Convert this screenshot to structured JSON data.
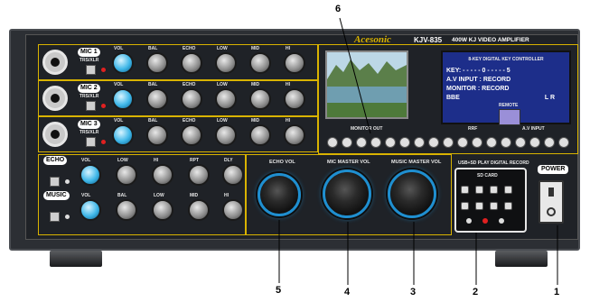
{
  "brand": {
    "logo": "Acesonic",
    "model": "KJV-835",
    "subtitle": "400W KJ VIDEO AMPLIFIER"
  },
  "mic_channels": [
    {
      "label": "MIC 1",
      "sub": "TRS/XLR"
    },
    {
      "label": "MIC 2",
      "sub": "TRS/XLR"
    },
    {
      "label": "MIC 3",
      "sub": "TRS/XLR"
    }
  ],
  "mic_knob_labels": [
    "VOL",
    "BAL",
    "ECHO",
    "LOW",
    "MID",
    "HI"
  ],
  "echo_section": {
    "label": "ECHO",
    "knob_labels": [
      "VOL",
      "LOW",
      "HI",
      "RPT",
      "DLY"
    ]
  },
  "music_section": {
    "label": "MUSIC",
    "knob_labels": [
      "VOL",
      "BAL",
      "LOW",
      "MID",
      "HI"
    ]
  },
  "master_knobs": [
    "ECHO VOL",
    "MIC MASTER VOL",
    "MUSIC MASTER VOL"
  ],
  "usb_section": {
    "title": "USB+SD PLAY DIGITAL RECORD",
    "card_label": "SD CARD"
  },
  "power_label": "POWER",
  "lcd": {
    "header": "8-KEY DIGITAL KEY CONTROLLER",
    "line1": "KEY:  - - - - - 0 - - - - - 5",
    "line2": "A.V INPUT : RECORD",
    "line3": "MONITOR : RECORD",
    "line4_left": "BBE",
    "line4_right": "L   R",
    "remote_label": "REMOTE"
  },
  "video_buttons_group": {
    "left_title": "MONITOR OUT",
    "mid_title": "RRF",
    "right_title": "A.V INPUT"
  },
  "callouts": [
    "6",
    "5",
    "4",
    "3",
    "2",
    "1"
  ],
  "colors": {
    "accent_blue": "#3fb7e8",
    "panel_yellow": "#d9b300",
    "chassis": "#2c2f34"
  }
}
